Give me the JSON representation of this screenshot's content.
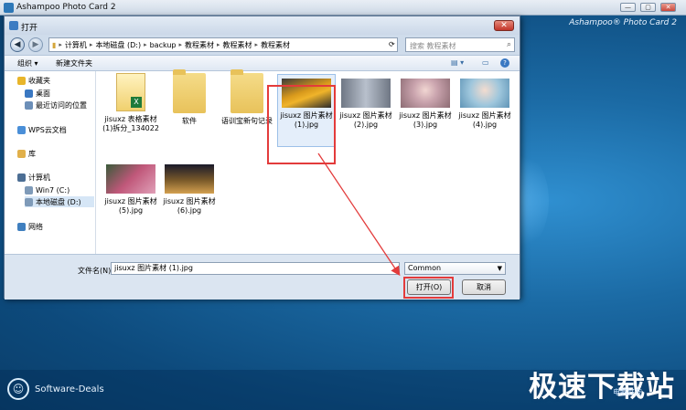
{
  "app": {
    "title": "Ashampoo Photo Card 2",
    "brand": "Ashampoo® Photo Card 2",
    "footer_label": "Software-Deals",
    "watermark": "极速下载站",
    "watermark_sub": "电脑好友",
    "min_label": "—",
    "max_label": "▢",
    "close_label": "✕"
  },
  "dialog": {
    "title": "打开",
    "close_label": "✕",
    "nav": {
      "back": "◀",
      "forward": "▶"
    },
    "breadcrumb": [
      "计算机",
      "本地磁盘 (D:)",
      "backup",
      "教程素材",
      "教程素材",
      "教程素材"
    ],
    "search_placeholder": "搜索 教程素材",
    "toolbar": {
      "organize": "组织 ▾",
      "new_folder": "新建文件夹"
    },
    "sidebar": [
      {
        "label": "收藏夹",
        "icon": "star-icon",
        "color": "#e8b52a"
      },
      {
        "label": "桌面",
        "icon": "desktop-icon",
        "color": "#3a78c2"
      },
      {
        "label": "最近访问的位置",
        "icon": "recent-icon",
        "color": "#6c8fb8"
      },
      {
        "label": "WPS云文档",
        "icon": "cloud-icon",
        "color": "#4a8fd8"
      },
      {
        "label": "库",
        "icon": "library-icon",
        "color": "#e1b04a"
      },
      {
        "label": "计算机",
        "icon": "computer-icon",
        "color": "#4c6e94"
      },
      {
        "label": "Win7 (C:)",
        "icon": "drive-icon",
        "color": "#7e9ab8"
      },
      {
        "label": "本地磁盘 (D:)",
        "icon": "drive-icon",
        "color": "#7e9ab8"
      },
      {
        "label": "网络",
        "icon": "network-icon",
        "color": "#3f7fbf"
      }
    ],
    "files": [
      {
        "name": "jisuxz 表格素材\n(1)拆分_134022",
        "type": "xls"
      },
      {
        "name": "软件",
        "type": "folder"
      },
      {
        "name": "语训宝新句记录",
        "type": "folder"
      },
      {
        "name": "jisuxz 图片素材\n(1).jpg",
        "type": "photo",
        "color": "#d99a1c"
      },
      {
        "name": "jisuxz 图片素材\n(2).jpg",
        "type": "photo",
        "color": "#8b96a5"
      },
      {
        "name": "jisuxz 图片素材\n(3).jpg",
        "type": "photo",
        "color": "#c9a3ad"
      },
      {
        "name": "jisuxz 图片素材\n(4).jpg",
        "type": "photo",
        "color": "#6fa8c8"
      },
      {
        "name": "jisuxz 图片素材\n(5).jpg",
        "type": "photo",
        "color": "#c0587a"
      },
      {
        "name": "jisuxz 图片素材\n(6).jpg",
        "type": "photo",
        "color": "#7a5a2a"
      }
    ],
    "filename_label": "文件名(N):",
    "filename_value": "jisuxz 图片素材 (1).jpg",
    "file_type": "Common",
    "open_button": "打开(O)",
    "cancel_button": "取消"
  },
  "colors": {
    "highlight": "#e33b3b",
    "selection": "#e4eefa"
  }
}
